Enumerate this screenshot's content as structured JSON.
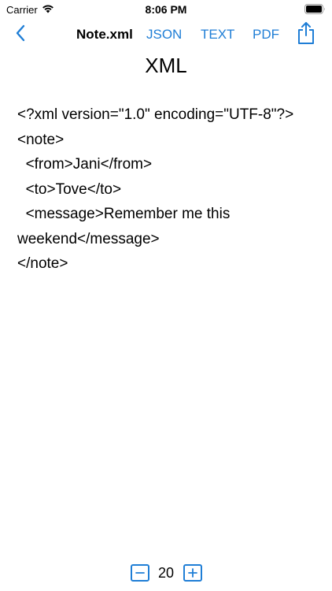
{
  "status_bar": {
    "carrier": "Carrier",
    "time": "8:06 PM",
    "icons": [
      "wifi-icon",
      "battery-icon"
    ]
  },
  "nav": {
    "back_icon": "chevron-left-icon",
    "title": "Note.xml",
    "links": {
      "json": "JSON",
      "text": "TEXT",
      "pdf": "PDF"
    },
    "share_icon": "share-icon",
    "accent_color": "#1f7ed6"
  },
  "heading": "XML",
  "content": {
    "lines": [
      "<?xml version=\"1.0\" encoding=\"UTF-8\"?>",
      "<note>",
      "  <from>Jani</from>",
      "  <to>Tove</to>",
      "  <message>Remember me this weekend</message>",
      "</note>"
    ]
  },
  "font_stepper": {
    "decrease_icon": "minus-icon",
    "value": "20",
    "increase_icon": "plus-icon"
  }
}
